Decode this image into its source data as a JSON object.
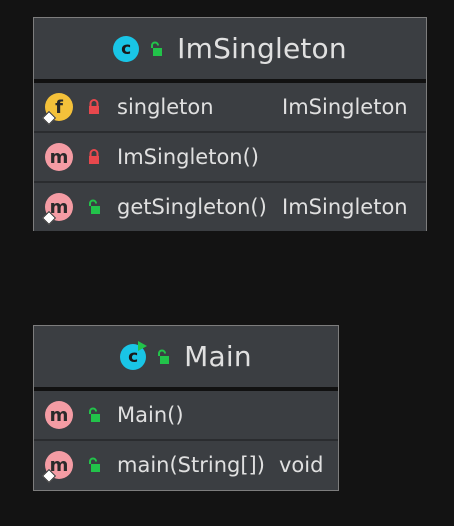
{
  "classes": [
    {
      "name": "ImSingleton",
      "members": [
        {
          "kind": "f",
          "visibility": "private",
          "name": "singleton",
          "type": "ImSingleton"
        },
        {
          "kind": "m",
          "visibility": "private",
          "name": "ImSingleton()",
          "type": ""
        },
        {
          "kind": "m",
          "visibility": "public",
          "name": "getSingleton()",
          "type": "ImSingleton"
        }
      ]
    },
    {
      "name": "Main",
      "members": [
        {
          "kind": "m",
          "visibility": "public",
          "name": "Main()",
          "type": ""
        },
        {
          "kind": "m",
          "visibility": "public",
          "name": "main(String[])",
          "type": "void"
        }
      ]
    }
  ],
  "badges": {
    "class": "c",
    "method": "m",
    "field": "f"
  },
  "colors": {
    "background": "#131313",
    "box": "#3b3e42",
    "class_badge": "#19c5e6",
    "method_badge": "#f49ca4",
    "field_badge": "#f4c13a",
    "private_lock": "#e8484d",
    "public_lock": "#22c34a"
  }
}
